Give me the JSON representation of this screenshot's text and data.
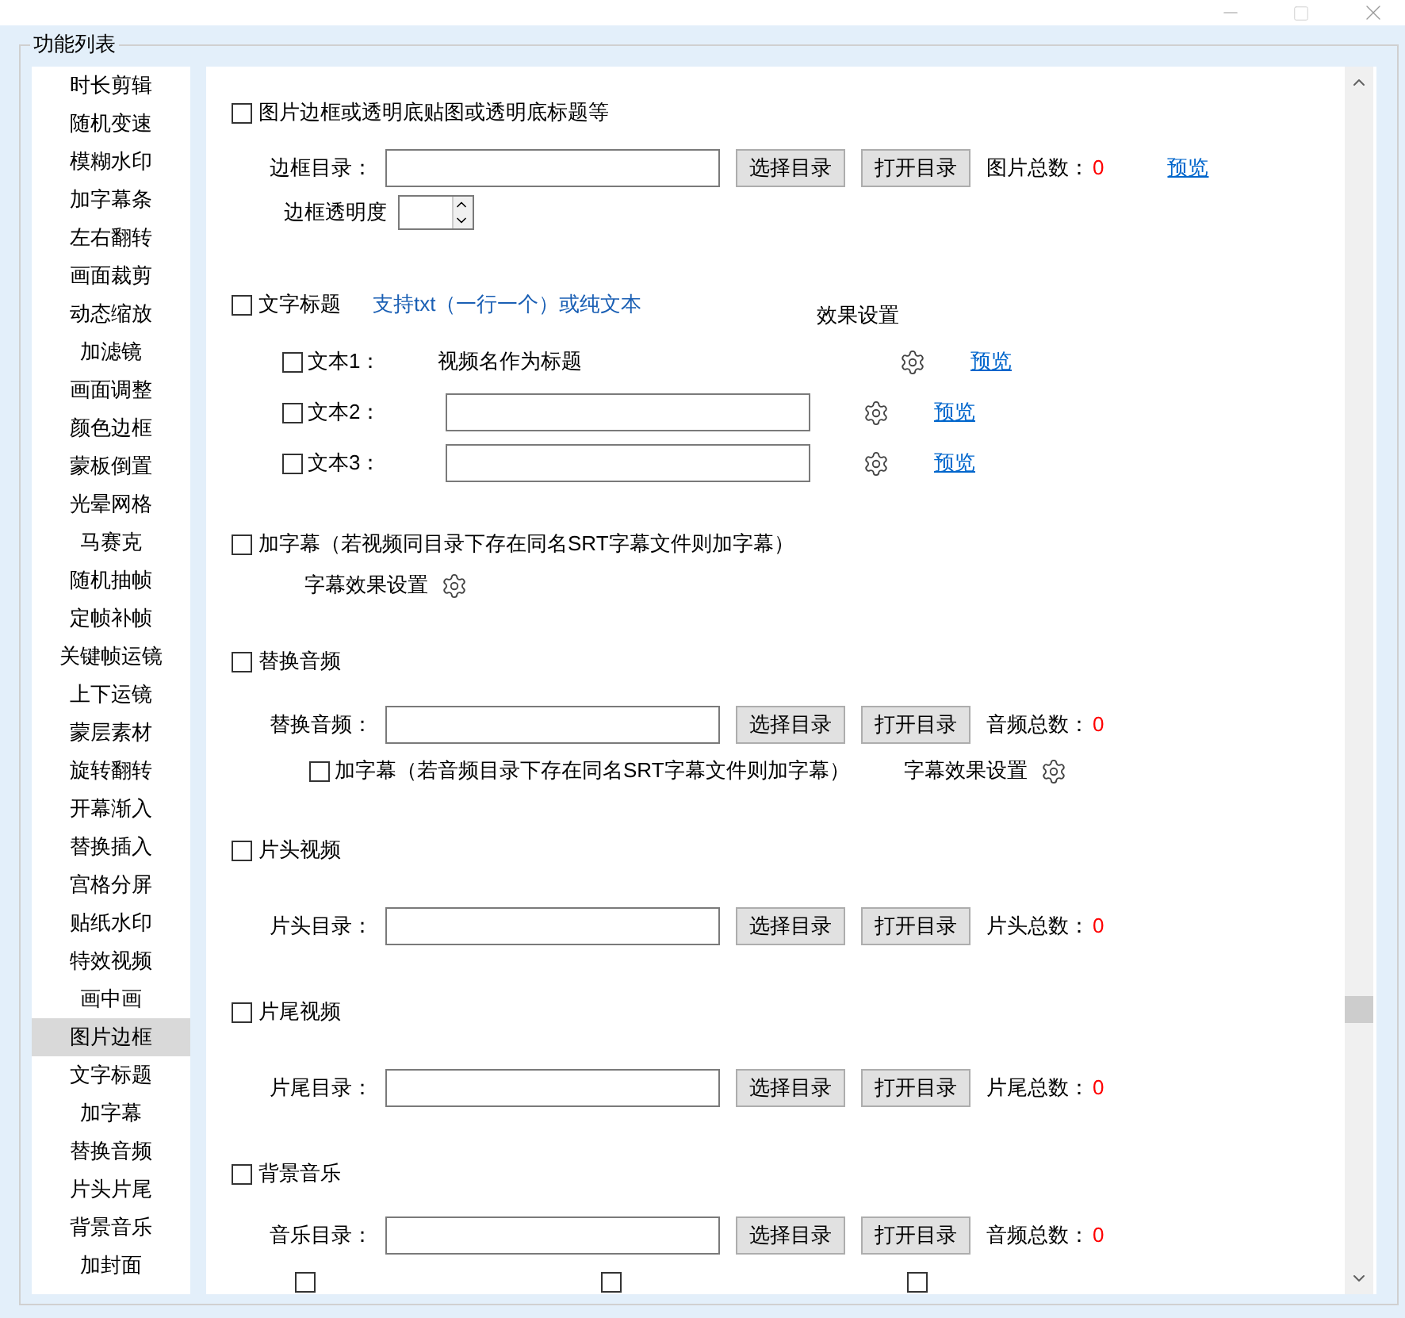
{
  "group_title": "功能列表",
  "sidebar": {
    "items": [
      {
        "label": "时长剪辑",
        "selected": false
      },
      {
        "label": "随机变速",
        "selected": false
      },
      {
        "label": "模糊水印",
        "selected": false
      },
      {
        "label": "加字幕条",
        "selected": false
      },
      {
        "label": "左右翻转",
        "selected": false
      },
      {
        "label": "画面裁剪",
        "selected": false
      },
      {
        "label": "动态缩放",
        "selected": false
      },
      {
        "label": "加滤镜",
        "selected": false
      },
      {
        "label": "画面调整",
        "selected": false
      },
      {
        "label": "颜色边框",
        "selected": false
      },
      {
        "label": "蒙板倒置",
        "selected": false
      },
      {
        "label": "光晕网格",
        "selected": false
      },
      {
        "label": "马赛克",
        "selected": false
      },
      {
        "label": "随机抽帧",
        "selected": false
      },
      {
        "label": "定帧补帧",
        "selected": false
      },
      {
        "label": "关键帧运镜",
        "selected": false
      },
      {
        "label": "上下运镜",
        "selected": false
      },
      {
        "label": "蒙层素材",
        "selected": false
      },
      {
        "label": "旋转翻转",
        "selected": false
      },
      {
        "label": "开幕渐入",
        "selected": false
      },
      {
        "label": "替换插入",
        "selected": false
      },
      {
        "label": "宫格分屏",
        "selected": false
      },
      {
        "label": "贴纸水印",
        "selected": false
      },
      {
        "label": "特效视频",
        "selected": false
      },
      {
        "label": "画中画",
        "selected": false
      },
      {
        "label": "图片边框",
        "selected": true
      },
      {
        "label": "文字标题",
        "selected": false
      },
      {
        "label": "加字幕",
        "selected": false
      },
      {
        "label": "替换音频",
        "selected": false
      },
      {
        "label": "片头片尾",
        "selected": false
      },
      {
        "label": "背景音乐",
        "selected": false
      },
      {
        "label": "加封面",
        "selected": false
      }
    ]
  },
  "sections": [
    {
      "kind": "image_border",
      "title": "图片边框或透明底贴图或透明底标题等",
      "checked": false,
      "dir": {
        "label": "边框目录：",
        "select": "选择目录",
        "open": "打开目录",
        "count_label": "图片总数：",
        "count": "0",
        "preview": "预览"
      },
      "opacity": {
        "label": "边框透明度"
      }
    },
    {
      "kind": "text_title",
      "title": "文字标题",
      "checked": false,
      "note": "支持txt（一行一个）或纯文本",
      "effect_header": "效果设置",
      "texts": [
        {
          "label": "文本1：",
          "checked": false,
          "value": "视频名作为标题",
          "preview": "预览"
        },
        {
          "label": "文本2：",
          "checked": false,
          "preview": "预览"
        },
        {
          "label": "文本3：",
          "checked": false,
          "preview": "预览"
        }
      ]
    },
    {
      "kind": "subtitle",
      "title": "加字幕（若视频同目录下存在同名SRT字幕文件则加字幕）",
      "checked": false,
      "effect_label": "字幕效果设置"
    },
    {
      "kind": "replace_audio",
      "title": "替换音频",
      "checked": false,
      "dir": {
        "label": "替换音频：",
        "select": "选择目录",
        "open": "打开目录",
        "count_label": "音频总数：",
        "count": "0"
      },
      "sub": {
        "label": "加字幕（若音频目录下存在同名SRT字幕文件则加字幕）",
        "checked": false,
        "effect_label": "字幕效果设置"
      }
    },
    {
      "kind": "clip",
      "title": "片头视频",
      "checked": false,
      "dir": {
        "label": "片头目录：",
        "select": "选择目录",
        "open": "打开目录",
        "count_label": "片头总数：",
        "count": "0"
      }
    },
    {
      "kind": "clip",
      "title": "片尾视频",
      "checked": false,
      "dir": {
        "label": "片尾目录：",
        "select": "选择目录",
        "open": "打开目录",
        "count_label": "片尾总数：",
        "count": "0"
      }
    },
    {
      "kind": "bgm",
      "title": "背景音乐",
      "checked": false,
      "dir": {
        "label": "音乐目录：",
        "select": "选择目录",
        "open": "打开目录",
        "count_label": "音频总数：",
        "count": "0"
      },
      "options": [
        {
          "checked": false
        },
        {
          "checked": false
        },
        {
          "checked": false
        }
      ]
    }
  ]
}
